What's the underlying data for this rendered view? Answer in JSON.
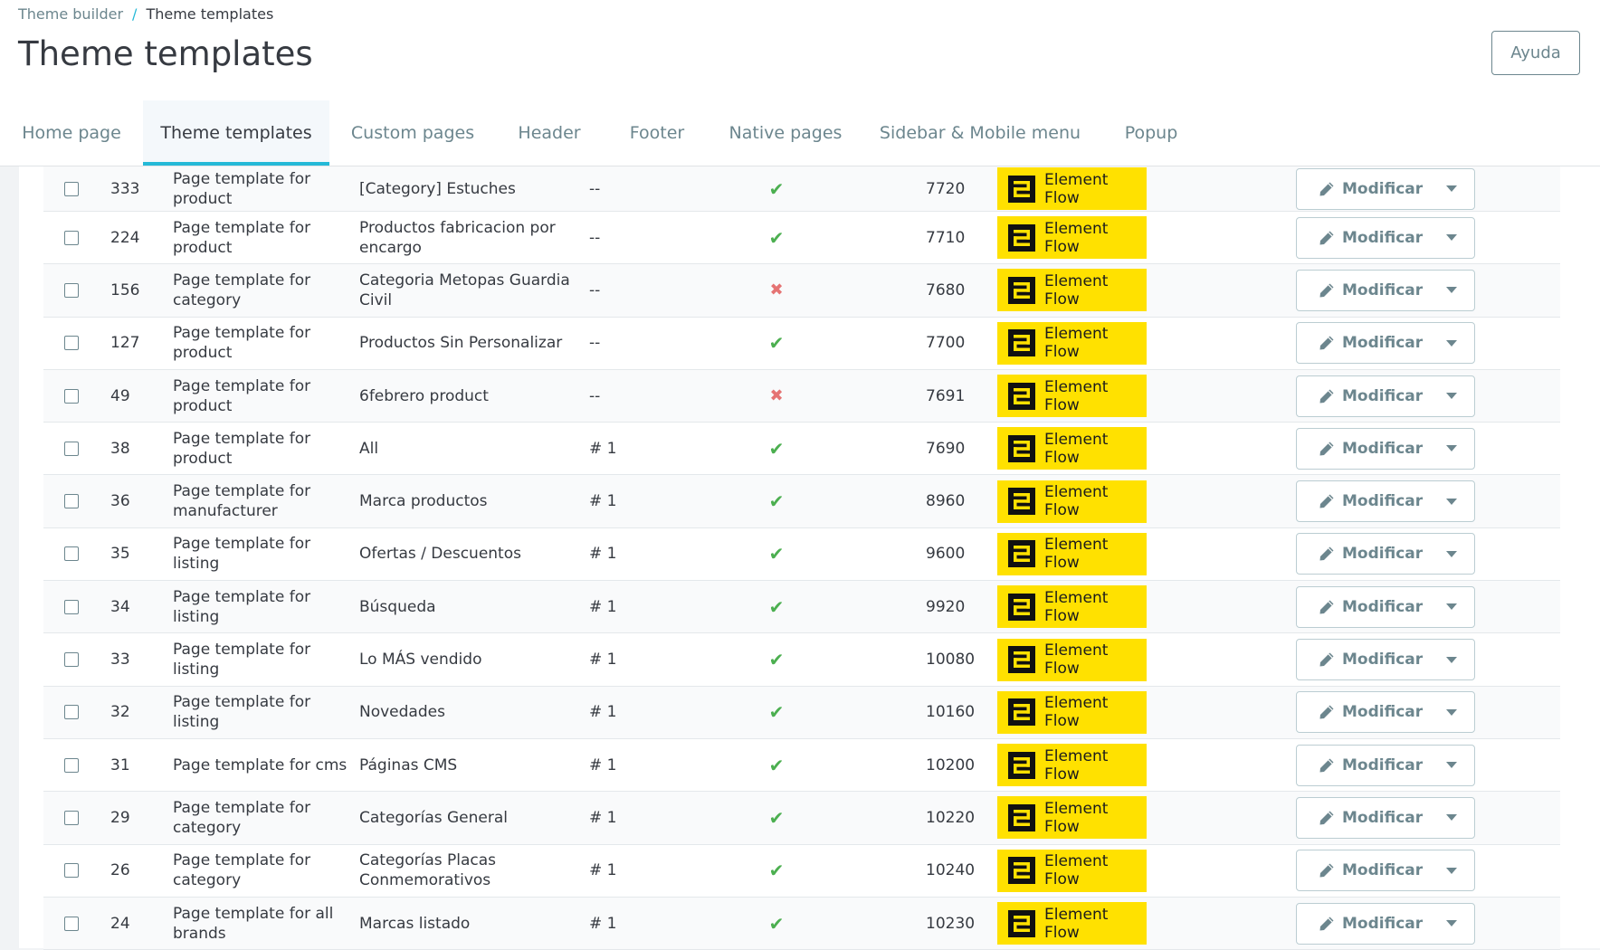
{
  "breadcrumb": {
    "parent": "Theme builder",
    "separator": "/",
    "current": "Theme templates"
  },
  "page_title": "Theme templates",
  "help_label": "Ayuda",
  "tabs": [
    {
      "label": "Home page"
    },
    {
      "label": "Theme templates"
    },
    {
      "label": "Custom pages"
    },
    {
      "label": "Header"
    },
    {
      "label": "Footer"
    },
    {
      "label": "Native pages"
    },
    {
      "label": "Sidebar & Mobile menu"
    },
    {
      "label": "Popup"
    }
  ],
  "active_tab": "Theme templates",
  "colors": {
    "accent": "#25b9d7",
    "badge": "#ffe100",
    "ok": "#4caf50",
    "no": "#e57373"
  },
  "badge_label": "Element Flow",
  "edit_label": "Modificar",
  "rows": [
    {
      "id": "333",
      "type": "Page template for product",
      "name": "[Category] Estuches",
      "assoc": "--",
      "active": true,
      "pos": "7720"
    },
    {
      "id": "224",
      "type": "Page template for product",
      "name": "Productos fabricacion por encargo",
      "assoc": "--",
      "active": true,
      "pos": "7710"
    },
    {
      "id": "156",
      "type": "Page template for category",
      "name": "Categoria Metopas Guardia Civil",
      "assoc": "--",
      "active": false,
      "pos": "7680"
    },
    {
      "id": "127",
      "type": "Page template for product",
      "name": "Productos Sin Personalizar",
      "assoc": "--",
      "active": true,
      "pos": "7700"
    },
    {
      "id": "49",
      "type": "Page template for product",
      "name": "6febrero product",
      "assoc": "--",
      "active": false,
      "pos": "7691"
    },
    {
      "id": "38",
      "type": "Page template for product",
      "name": "All",
      "assoc": "# 1",
      "active": true,
      "pos": "7690"
    },
    {
      "id": "36",
      "type": "Page template for manufacturer",
      "name": "Marca productos",
      "assoc": "# 1",
      "active": true,
      "pos": "8960"
    },
    {
      "id": "35",
      "type": "Page template for listing",
      "name": "Ofertas / Descuentos",
      "assoc": "# 1",
      "active": true,
      "pos": "9600"
    },
    {
      "id": "34",
      "type": "Page template for listing",
      "name": "Búsqueda",
      "assoc": "# 1",
      "active": true,
      "pos": "9920"
    },
    {
      "id": "33",
      "type": "Page template for listing",
      "name": "Lo MÁS vendido",
      "assoc": "# 1",
      "active": true,
      "pos": "10080"
    },
    {
      "id": "32",
      "type": "Page template for listing",
      "name": "Novedades",
      "assoc": "# 1",
      "active": true,
      "pos": "10160"
    },
    {
      "id": "31",
      "type": "Page template for cms",
      "name": "Páginas CMS",
      "assoc": "# 1",
      "active": true,
      "pos": "10200"
    },
    {
      "id": "29",
      "type": "Page template for category",
      "name": "Categorías General",
      "assoc": "# 1",
      "active": true,
      "pos": "10220"
    },
    {
      "id": "26",
      "type": "Page template for category",
      "name": "Categorías Placas Conmemorativos",
      "assoc": "# 1",
      "active": true,
      "pos": "10240"
    },
    {
      "id": "24",
      "type": "Page template for all brands",
      "name": "Marcas listado",
      "assoc": "# 1",
      "active": true,
      "pos": "10230"
    }
  ]
}
